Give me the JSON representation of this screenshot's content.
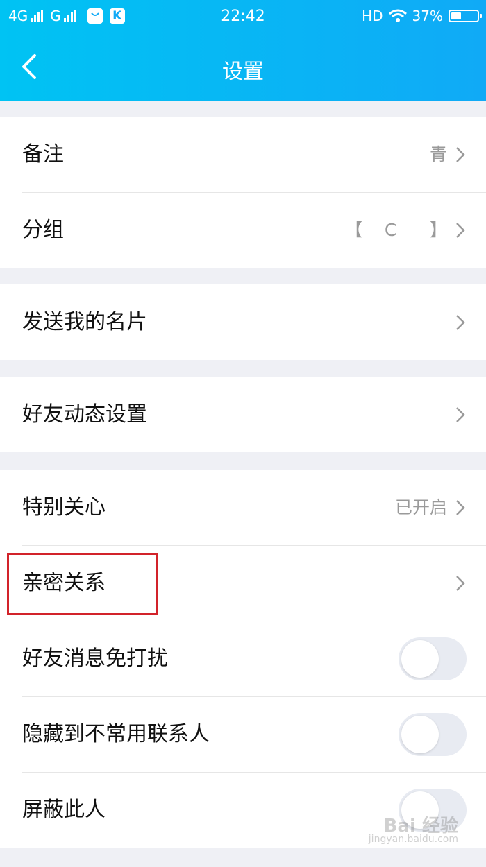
{
  "status_bar": {
    "network1": "4G",
    "network2": "G",
    "time": "22:42",
    "hd": "HD",
    "battery": "37%",
    "k_icon": "K",
    "icons": [
      "signal-icon",
      "shopping-bag-icon",
      "k-app-icon",
      "wifi-icon",
      "battery-icon"
    ]
  },
  "header": {
    "title": "设置"
  },
  "groups": {
    "g1": [
      {
        "label": "备注",
        "value": "青"
      },
      {
        "label": "分组",
        "value": "【    C      】"
      }
    ],
    "g2": [
      {
        "label": "发送我的名片"
      }
    ],
    "g3": [
      {
        "label": "好友动态设置"
      }
    ],
    "g4": [
      {
        "label": "特别关心",
        "value": "已开启"
      },
      {
        "label": "亲密关系"
      },
      {
        "label": "好友消息免打扰",
        "toggle": false
      },
      {
        "label": "隐藏到不常用联系人",
        "toggle": false
      },
      {
        "label": "屏蔽此人",
        "toggle": false
      }
    ]
  },
  "watermark": {
    "text": "Bai 经验",
    "sub": "jingyan.baidu.com"
  },
  "colors": {
    "header_start": "#00c3f3",
    "header_end": "#10aaf6",
    "highlight": "#d2232a",
    "background": "#eff0f5"
  }
}
